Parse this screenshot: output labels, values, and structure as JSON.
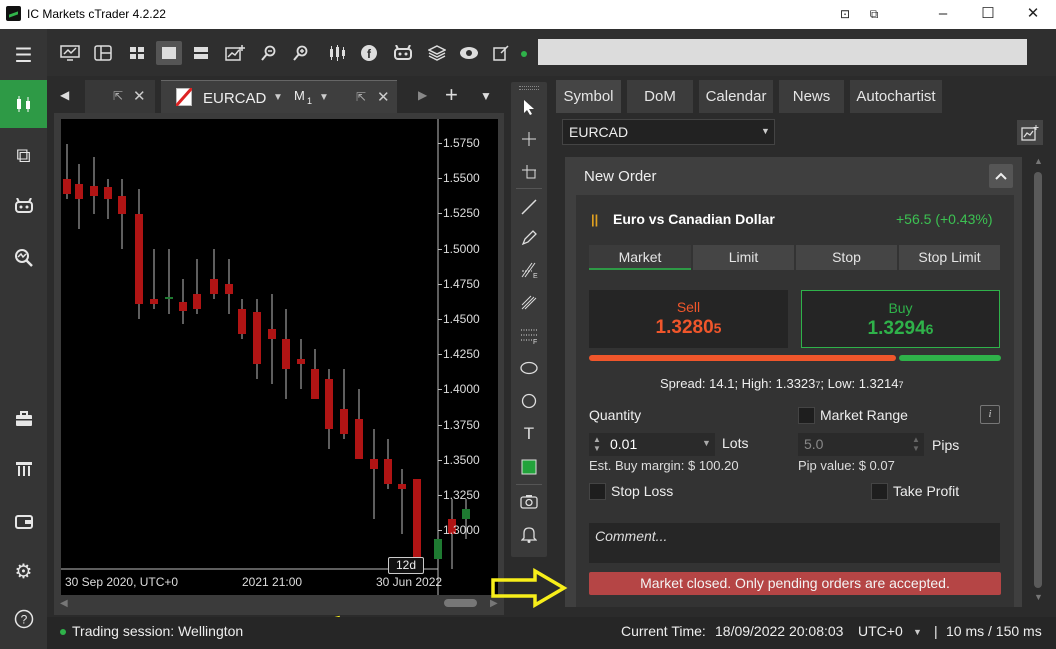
{
  "window": {
    "title": "IC Markets cTrader 4.2.22"
  },
  "chart_tabs": {
    "active_symbol": "EURCAD",
    "timeframe": "M",
    "timeframe_sub": "1"
  },
  "chart": {
    "price_labels": [
      "1.5750",
      "1.5500",
      "1.5250",
      "1.5000",
      "1.4750",
      "1.4500",
      "1.4250",
      "1.4000",
      "1.3750",
      "1.3500",
      "1.3250",
      "1.3000"
    ],
    "x_labels": [
      "30 Sep 2020, UTC+0",
      "2021 21:00",
      "30 Jun 2022"
    ],
    "scale_marker": "12d",
    "bull_color": "#1e7a31",
    "bear_color": "#b01414"
  },
  "panel": {
    "tabs": [
      "Symbol",
      "DoM",
      "Calendar",
      "News",
      "Autochartist"
    ],
    "symbol_select": "EURCAD",
    "new_order_title": "New Order",
    "symbol_name": "Euro vs Canadian Dollar",
    "change": "+56.5 (+0.43%)",
    "order_types": [
      "Market",
      "Limit",
      "Stop",
      "Stop Limit"
    ],
    "sell_label": "Sell",
    "sell_price_main": "1.3280",
    "sell_price_pip": "5",
    "buy_label": "Buy",
    "buy_price_main": "1.3294",
    "buy_price_pip": "6",
    "spread_text": "Spread: 14.1; High: 1.3323",
    "spread_high_pip": "7",
    "spread_low_text": "; Low: 1.3214",
    "spread_low_pip": "7",
    "quantity_label": "Quantity",
    "market_range_label": "Market Range",
    "quantity_value": "0.01",
    "lots_label": "Lots",
    "pips_value": "5.0",
    "pips_label": "Pips",
    "est_margin": "Est. Buy margin: $ 100.20",
    "pip_value": "Pip value: $ 0.07",
    "stop_loss_label": "Stop Loss",
    "take_profit_label": "Take Profit",
    "comment_placeholder": "Comment...",
    "market_closed": "Market closed. Only pending orders are accepted.",
    "sell_color": "#f0562b",
    "buy_color": "#2fb24a",
    "closed_bg": "#b54545"
  },
  "status": {
    "session": "Trading session: Wellington",
    "current_time_label": "Current Time:",
    "current_time": "18/09/2022 20:08:03",
    "timezone": "UTC+0",
    "latency": "10 ms / 150 ms"
  }
}
